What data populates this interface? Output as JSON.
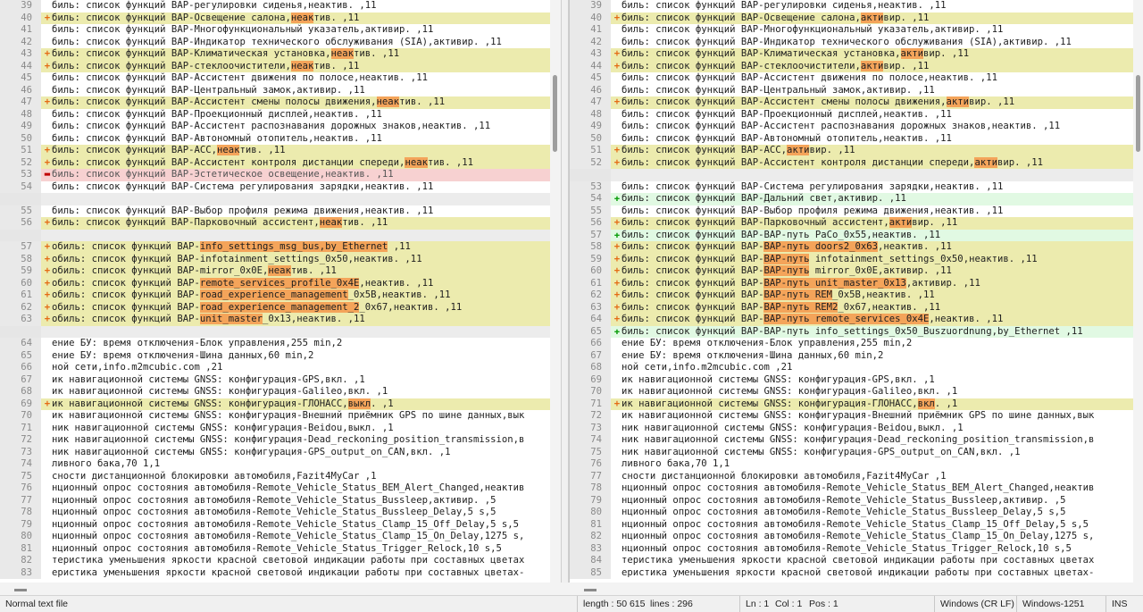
{
  "left_lines": [
    {
      "n": "39",
      "t": "normal",
      "c": "биль: список функций BAP-регулировки сиденья,неактив. ,11"
    },
    {
      "n": "40",
      "t": "changed",
      "c": "биль: список функций BAP-Освещение салона,",
      "h": "неак",
      "r": "тив. ,11"
    },
    {
      "n": "41",
      "t": "normal",
      "c": "биль: список функций BAP-Многофункциональный указатель,активир. ,11"
    },
    {
      "n": "42",
      "t": "normal",
      "c": "биль: список функций BAP-Индикатор технического обслуживания (SIA),активир. ,11"
    },
    {
      "n": "43",
      "t": "changed",
      "c": "биль: список функций BAP-Климатическая установка,",
      "h": "неак",
      "r": "тив. ,11"
    },
    {
      "n": "44",
      "t": "changed",
      "c": "биль: список функций BAP-стеклоочистители,",
      "h": "неак",
      "r": "тив. ,11"
    },
    {
      "n": "45",
      "t": "normal",
      "c": "биль: список функций BAP-Ассистент движения по полосе,неактив. ,11"
    },
    {
      "n": "46",
      "t": "normal",
      "c": "биль: список функций BAP-Центральный замок,активир. ,11"
    },
    {
      "n": "47",
      "t": "changed",
      "c": "биль: список функций BAP-Ассистент смены полосы движения,",
      "h": "неак",
      "r": "тив. ,11"
    },
    {
      "n": "48",
      "t": "normal",
      "c": "биль: список функций BAP-Проекционный дисплей,неактив. ,11"
    },
    {
      "n": "49",
      "t": "normal",
      "c": "биль: список функций BAP-Ассистент распознавания дорожных знаков,неактив. ,11"
    },
    {
      "n": "50",
      "t": "normal",
      "c": "биль: список функций BAP-Автономный отопитель,неактив. ,11"
    },
    {
      "n": "51",
      "t": "changed",
      "c": "биль: список функций BAP-ACC,",
      "h": "неак",
      "r": "тив. ,11"
    },
    {
      "n": "52",
      "t": "changed",
      "c": "биль: список функций BAP-Ассистент контроля дистанции спереди,",
      "h": "неак",
      "r": "тив. ,11"
    },
    {
      "n": "53",
      "t": "deleted",
      "c": "биль: список функций BAP-Эстетическое освещение,неактив. ,11"
    },
    {
      "n": "54",
      "t": "normal",
      "c": "биль: список функций BAP-Система регулирования зарядки,неактив. ,11"
    },
    {
      "n": "",
      "t": "blank",
      "c": ""
    },
    {
      "n": "55",
      "t": "normal",
      "c": "биль: список функций BAP-Выбор профиля режима движения,неактив. ,11"
    },
    {
      "n": "56",
      "t": "changed",
      "c": "биль: список функций BAP-Парковочный ассистент,",
      "h": "неак",
      "r": "тив. ,11"
    },
    {
      "n": "",
      "t": "blank",
      "c": ""
    },
    {
      "n": "57",
      "t": "changed",
      "c": "обиль: список функций BAP-",
      "h": "info_settings_msg_bus,by_Ethernet",
      "r": " ,11"
    },
    {
      "n": "58",
      "t": "changed",
      "c": "обиль: список функций BAP-infotainment_settings_0x50,неактив. ,11"
    },
    {
      "n": "59",
      "t": "changed",
      "c": "обиль: список функций BAP-mirror_0x0E,",
      "h": "неак",
      "r": "тив. ,11"
    },
    {
      "n": "60",
      "t": "changed",
      "c": "обиль: список функций BAP-",
      "h": "remote_services_profile_0x4E",
      "r": ",неактив. ,11"
    },
    {
      "n": "61",
      "t": "changed",
      "c": "обиль: список функций BAP-",
      "h": "road_experience_management",
      "r": "_0x5B,неактив. ,11"
    },
    {
      "n": "62",
      "t": "changed",
      "c": "обиль: список функций BAP-",
      "h": "road_experience_management_2",
      "r": "_0x67,неактив. ,11"
    },
    {
      "n": "63",
      "t": "changed",
      "c": "обиль: список функций BAP-",
      "h": "unit_master",
      "r": "_0x13,неактив. ,11"
    },
    {
      "n": "",
      "t": "blank",
      "c": ""
    },
    {
      "n": "64",
      "t": "normal",
      "c": "ение БУ: время отключения-Блок управления,255 min,2"
    },
    {
      "n": "65",
      "t": "normal",
      "c": "ение БУ: время отключения-Шина данных,60 min,2"
    },
    {
      "n": "66",
      "t": "normal",
      "c": "ной сети,info.m2mcubic.com ,21"
    },
    {
      "n": "67",
      "t": "normal",
      "c": "ик навигационной системы GNSS: конфигурация-GPS,вкл. ,1"
    },
    {
      "n": "68",
      "t": "normal",
      "c": "ик навигационной системы GNSS: конфигурация-Galileo,вкл. ,1"
    },
    {
      "n": "69",
      "t": "changed",
      "c": "ик навигационной системы GNSS: конфигурация-ГЛОНАСС,",
      "h": "выкл",
      "r": ". ,1"
    },
    {
      "n": "70",
      "t": "normal",
      "c": "ик навигационной системы GNSS: конфигурация-Внешний приёмник GPS по шине данных,вык"
    },
    {
      "n": "71",
      "t": "normal",
      "c": "ник навигационной системы GNSS: конфигурация-Beidou,выкл. ,1"
    },
    {
      "n": "72",
      "t": "normal",
      "c": "ник навигационной системы GNSS: конфигурация-Dead_reckoning_position_transmission,в"
    },
    {
      "n": "73",
      "t": "normal",
      "c": "ник навигационной системы GNSS: конфигурация-GPS_output_on_CAN,вкл. ,1"
    },
    {
      "n": "74",
      "t": "normal",
      "c": "ливного бака,70 1,1"
    },
    {
      "n": "75",
      "t": "normal",
      "c": "сности дистанционной блокировки автомобиля,Fazit4MyCar ,1"
    },
    {
      "n": "76",
      "t": "normal",
      "c": "нционный опрос состояния автомобиля-Remote_Vehicle_Status_BEM_Alert_Changed,неактив"
    },
    {
      "n": "77",
      "t": "normal",
      "c": "нционный опрос состояния автомобиля-Remote_Vehicle_Status_Bussleep,активир. ,5"
    },
    {
      "n": "78",
      "t": "normal",
      "c": "нционный опрос состояния автомобиля-Remote_Vehicle_Status_Bussleep_Delay,5 s,5"
    },
    {
      "n": "79",
      "t": "normal",
      "c": "нционный опрос состояния автомобиля-Remote_Vehicle_Status_Clamp_15_Off_Delay,5 s,5"
    },
    {
      "n": "80",
      "t": "normal",
      "c": "нционный опрос состояния автомобиля-Remote_Vehicle_Status_Clamp_15_On_Delay,1275 s,"
    },
    {
      "n": "81",
      "t": "normal",
      "c": "нционный опрос состояния автомобиля-Remote_Vehicle_Status_Trigger_Relock,10 s,5"
    },
    {
      "n": "82",
      "t": "normal",
      "c": "теристика уменьшения яркости красной световой индикации работы при составных цветах"
    },
    {
      "n": "83",
      "t": "normal",
      "c": "еристика уменьшения яркости красной световой индикации работы при составных цветах-"
    }
  ],
  "right_lines": [
    {
      "n": "39",
      "t": "normal",
      "c": "биль: список функций BAP-регулировки сиденья,неактив. ,11"
    },
    {
      "n": "40",
      "t": "changed",
      "c": "биль: список функций BAP-Освещение салона,",
      "h": "акти",
      "r": "вир. ,11"
    },
    {
      "n": "41",
      "t": "normal",
      "c": "биль: список функций BAP-Многофункциональный указатель,активир. ,11"
    },
    {
      "n": "42",
      "t": "normal",
      "c": "биль: список функций BAP-Индикатор технического обслуживания (SIA),активир. ,11"
    },
    {
      "n": "43",
      "t": "changed",
      "c": "биль: список функций BAP-Климатическая установка,",
      "h": "акти",
      "r": "вир. ,11"
    },
    {
      "n": "44",
      "t": "changed",
      "c": "биль: список функций BAP-стеклоочистители,",
      "h": "акти",
      "r": "вир. ,11"
    },
    {
      "n": "45",
      "t": "normal",
      "c": "биль: список функций BAP-Ассистент движения по полосе,неактив. ,11"
    },
    {
      "n": "46",
      "t": "normal",
      "c": "биль: список функций BAP-Центральный замок,активир. ,11"
    },
    {
      "n": "47",
      "t": "changed",
      "c": "биль: список функций BAP-Ассистент смены полосы движения,",
      "h": "акти",
      "r": "вир. ,11"
    },
    {
      "n": "48",
      "t": "normal",
      "c": "биль: список функций BAP-Проекционный дисплей,неактив. ,11"
    },
    {
      "n": "49",
      "t": "normal",
      "c": "биль: список функций BAP-Ассистент распознавания дорожных знаков,неактив. ,11"
    },
    {
      "n": "50",
      "t": "normal",
      "c": "биль: список функций BAP-Автономный отопитель,неактив. ,11"
    },
    {
      "n": "51",
      "t": "changed",
      "c": "биль: список функций BAP-ACC,",
      "h": "акти",
      "r": "вир. ,11"
    },
    {
      "n": "52",
      "t": "changed",
      "c": "биль: список функций BAP-Ассистент контроля дистанции спереди,",
      "h": "акти",
      "r": "вир. ,11"
    },
    {
      "n": "",
      "t": "blank",
      "c": ""
    },
    {
      "n": "53",
      "t": "normal",
      "c": "биль: список функций BAP-Система регулирования зарядки,неактив. ,11"
    },
    {
      "n": "54",
      "t": "added",
      "c": "биль: список функций BAP-Дальний свет,активир. ,11"
    },
    {
      "n": "55",
      "t": "normal",
      "c": "биль: список функций BAP-Выбор профиля режима движения,неактив. ,11"
    },
    {
      "n": "56",
      "t": "changed",
      "c": "биль: список функций BAP-Парковочный ассистент,",
      "h": "акти",
      "r": "вир. ,11"
    },
    {
      "n": "57",
      "t": "added",
      "c": "биль: список функций BAP-BAP-путь PaCo_0x55,неактив. ,11"
    },
    {
      "n": "58",
      "t": "changed",
      "c": "биль: список функций BAP-",
      "h": "BAP-путь doors2_0x63",
      "r": ",неактив. ,11"
    },
    {
      "n": "59",
      "t": "changed",
      "c": "биль: список функций BAP-",
      "h": "BAP-путь",
      "r": " infotainment_settings_0x50,неактив. ,11"
    },
    {
      "n": "60",
      "t": "changed",
      "c": "биль: список функций BAP-",
      "h": "BAP-путь",
      "r": " mirror_0x0E,активир. ,11"
    },
    {
      "n": "61",
      "t": "changed",
      "c": "биль: список функций BAP-",
      "h": "BAP-путь unit_master_0x13",
      "r": ",активир. ,11"
    },
    {
      "n": "62",
      "t": "changed",
      "c": "биль: список функций BAP-",
      "h": "BAP-путь REM",
      "r": "_0x5B,неактив. ,11"
    },
    {
      "n": "63",
      "t": "changed",
      "c": "биль: список функций BAP-",
      "h": "BAP-путь REM2",
      "r": "_0x67,неактив. ,11"
    },
    {
      "n": "64",
      "t": "changed",
      "c": "биль: список функций BAP-",
      "h": "BAP-путь remote_services_0x4E",
      "r": ",неактив. ,11"
    },
    {
      "n": "65",
      "t": "added",
      "c": "биль: список функций BAP-BAP-путь info_settings_0x50_Buszuordnung,by_Ethernet ,11"
    },
    {
      "n": "66",
      "t": "normal",
      "c": "ение БУ: время отключения-Блок управления,255 min,2"
    },
    {
      "n": "67",
      "t": "normal",
      "c": "ение БУ: время отключения-Шина данных,60 min,2"
    },
    {
      "n": "68",
      "t": "normal",
      "c": "ной сети,info.m2mcubic.com ,21"
    },
    {
      "n": "69",
      "t": "normal",
      "c": "ик навигационной системы GNSS: конфигурация-GPS,вкл. ,1"
    },
    {
      "n": "70",
      "t": "normal",
      "c": "ик навигационной системы GNSS: конфигурация-Galileo,вкл. ,1"
    },
    {
      "n": "71",
      "t": "changed",
      "c": "ик навигационной системы GNSS: конфигурация-ГЛОНАСС,",
      "h": "вкл",
      "r": ". ,1"
    },
    {
      "n": "72",
      "t": "normal",
      "c": "ик навигационной системы GNSS: конфигурация-Внешний приёмник GPS по шине данных,вык"
    },
    {
      "n": "73",
      "t": "normal",
      "c": "ник навигационной системы GNSS: конфигурация-Beidou,выкл. ,1"
    },
    {
      "n": "74",
      "t": "normal",
      "c": "ник навигационной системы GNSS: конфигурация-Dead_reckoning_position_transmission,в"
    },
    {
      "n": "75",
      "t": "normal",
      "c": "ник навигационной системы GNSS: конфигурация-GPS_output_on_CAN,вкл. ,1"
    },
    {
      "n": "76",
      "t": "normal",
      "c": "ливного бака,70 1,1"
    },
    {
      "n": "77",
      "t": "normal",
      "c": "сности дистанционной блокировки автомобиля,Fazit4MyCar ,1"
    },
    {
      "n": "78",
      "t": "normal",
      "c": "нционный опрос состояния автомобиля-Remote_Vehicle_Status_BEM_Alert_Changed,неактив"
    },
    {
      "n": "79",
      "t": "normal",
      "c": "нционный опрос состояния автомобиля-Remote_Vehicle_Status_Bussleep,активир. ,5"
    },
    {
      "n": "80",
      "t": "normal",
      "c": "нционный опрос состояния автомобиля-Remote_Vehicle_Status_Bussleep_Delay,5 s,5"
    },
    {
      "n": "81",
      "t": "normal",
      "c": "нционный опрос состояния автомобиля-Remote_Vehicle_Status_Clamp_15_Off_Delay,5 s,5"
    },
    {
      "n": "82",
      "t": "normal",
      "c": "нционный опрос состояния автомобиля-Remote_Vehicle_Status_Clamp_15_On_Delay,1275 s,"
    },
    {
      "n": "83",
      "t": "normal",
      "c": "нционный опрос состояния автомобиля-Remote_Vehicle_Status_Trigger_Relock,10 s,5"
    },
    {
      "n": "84",
      "t": "normal",
      "c": "теристика уменьшения яркости красной световой индикации работы при составных цветах"
    },
    {
      "n": "85",
      "t": "normal",
      "c": "еристика уменьшения яркости красной световой индикации работы при составных цветах-"
    }
  ],
  "markers": {
    "changed": "+",
    "deleted": "▬",
    "added": "✚"
  },
  "colors": {
    "changed_bg": "#ecebae",
    "deleted_bg": "#f7d1d1",
    "added_bg": "#e1f9e3",
    "highlight": "#f4a45a"
  },
  "status": {
    "file_type": "Normal text file",
    "length": "length : 50 615",
    "lines": "lines : 296",
    "ln": "Ln : 1",
    "col": "Col : 1",
    "pos": "Pos : 1",
    "eol": "Windows (CR LF)",
    "encoding": "Windows-1251",
    "mode": "INS"
  }
}
